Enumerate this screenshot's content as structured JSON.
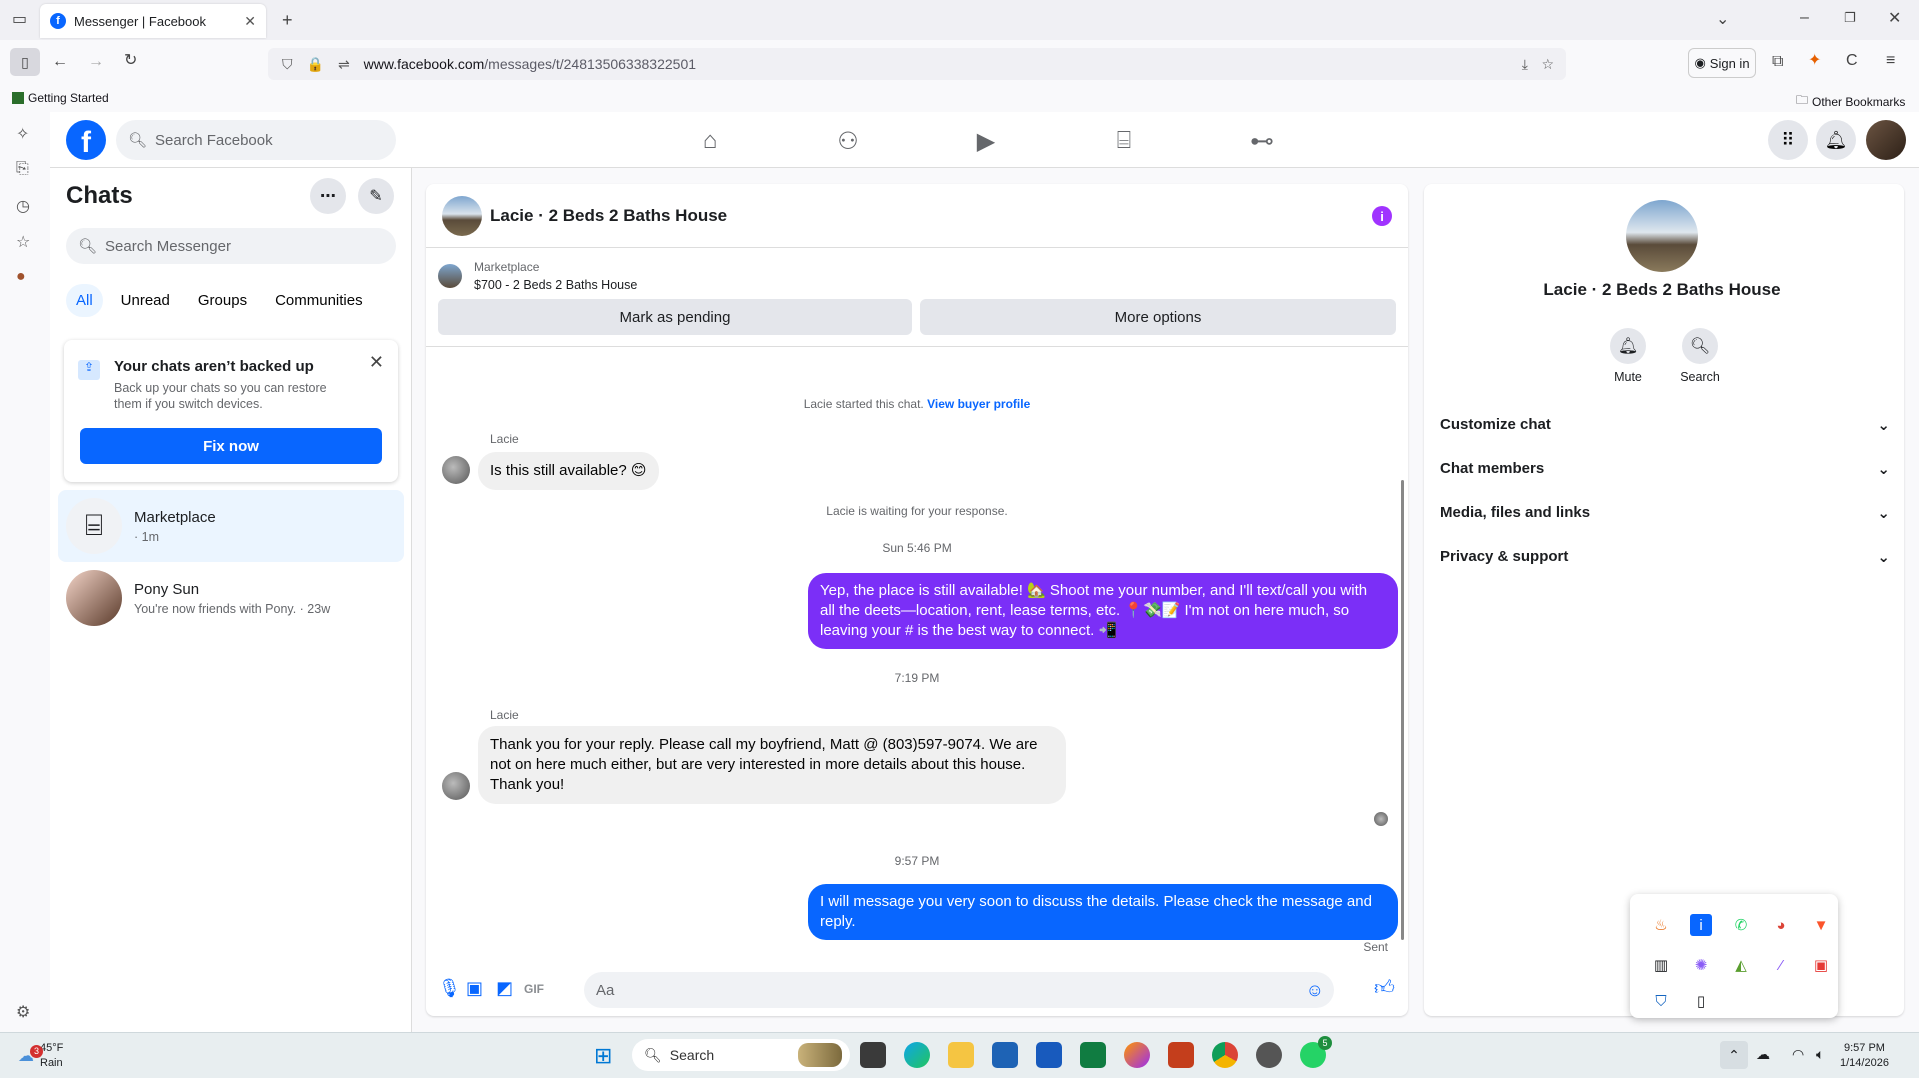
{
  "browser": {
    "tab_title": "Messenger | Facebook",
    "url_host": "www.facebook.com",
    "url_path": "/messages/t/24813506338322501",
    "sign_in": "Sign in",
    "bookmark_left": "Getting Started",
    "bookmark_right": "Other Bookmarks"
  },
  "fb": {
    "logo": "f",
    "search_placeholder": "Search Facebook"
  },
  "chatlist": {
    "title": "Chats",
    "search_placeholder": "Search Messenger",
    "filters": [
      "All",
      "Unread",
      "Groups",
      "Communities"
    ],
    "backup_title": "Your chats aren’t backed up",
    "backup_desc": "Back up your chats so you can restore them if you switch devices.",
    "backup_button": "Fix now",
    "items": [
      {
        "name": "Marketplace",
        "sub": "· 1m"
      },
      {
        "name": "Pony Sun",
        "sub": "You're now friends with Pony. · 23w"
      }
    ]
  },
  "conversation": {
    "title": "Lacie · 2 Beds 2 Baths House",
    "marketplace_label": "Marketplace",
    "listing": "$700 - 2 Beds 2 Baths House",
    "btn_pending": "Mark as pending",
    "btn_more": "More options",
    "started_text": "Lacie started this chat.",
    "view_profile": "View buyer profile",
    "sender1": "Lacie",
    "msg1": "Is this still available? 😊",
    "waiting": "Lacie is waiting for your response.",
    "time1": "Sun 5:46 PM",
    "msg2": "Yep, the place is still available! 🏡 Shoot me your number, and I'll text/call you with all the deets—location, rent, lease terms, etc. 📍💸📝 I'm not on here much, so leaving your # is the best way to connect. 📲",
    "time2": "7:19 PM",
    "sender2": "Lacie",
    "msg3": "Thank you for your reply.  Please call my boyfriend, Matt @ (803)597-9074.  We are not on here much either, but are very interested in more details about this house.  Thank you!",
    "time3": "9:57 PM",
    "msg4": "I will message you very soon to discuss the details. Please check the message and reply.",
    "sent": "Sent",
    "composer_placeholder": "Aa"
  },
  "infopane": {
    "title": "Lacie · 2 Beds 2 Baths House",
    "mute": "Mute",
    "search": "Search",
    "sections": [
      "Customize chat",
      "Chat members",
      "Media, files and links",
      "Privacy & support"
    ]
  },
  "taskbar": {
    "temp": "45°F",
    "weather": "Rain",
    "weather_badge": "3",
    "search": "Search",
    "time": "9:57 PM",
    "date": "1/14/2026",
    "whatsapp_badge": "5"
  },
  "colors": {
    "fb_blue": "#0866ff",
    "purple_bubble": "#7b2ff7"
  }
}
